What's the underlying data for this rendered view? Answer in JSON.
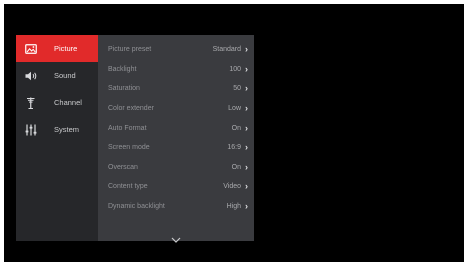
{
  "colors": {
    "background": "#000000",
    "sidebar": "#26272a",
    "panel": "#3a3b3f",
    "accent": "#e12a2a"
  },
  "categories": [
    {
      "label": "Picture",
      "icon": "picture-icon",
      "active": true
    },
    {
      "label": "Sound",
      "icon": "speaker-icon",
      "active": false
    },
    {
      "label": "Channel",
      "icon": "antenna-icon",
      "active": false
    },
    {
      "label": "System",
      "icon": "sliders-icon",
      "active": false
    }
  ],
  "settings": [
    {
      "name": "Picture preset",
      "value": "Standard"
    },
    {
      "name": "Backlight",
      "value": "100"
    },
    {
      "name": "Saturation",
      "value": "50"
    },
    {
      "name": "Color extender",
      "value": "Low"
    },
    {
      "name": "Auto Format",
      "value": "On"
    },
    {
      "name": "Screen mode",
      "value": "16:9"
    },
    {
      "name": "Overscan",
      "value": "On"
    },
    {
      "name": "Content type",
      "value": "Video"
    },
    {
      "name": "Dynamic backlight",
      "value": "High"
    }
  ],
  "scroll_indicator": "chevron-down-icon"
}
